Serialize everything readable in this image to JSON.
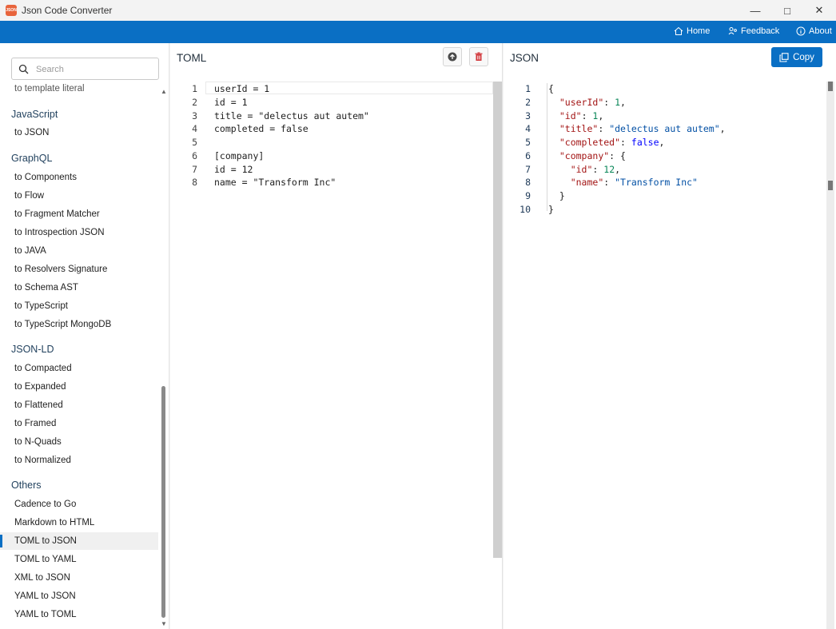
{
  "window": {
    "title": "Json Code Converter",
    "icon_text": "JSON",
    "icon_name": "app-icon"
  },
  "nav": {
    "home": "Home",
    "feedback": "Feedback",
    "about": "About"
  },
  "search": {
    "placeholder": "Search",
    "value": ""
  },
  "sidebar": {
    "cut_item": "to template literal",
    "sections": [
      {
        "title": "JavaScript",
        "items": [
          "to JSON"
        ]
      },
      {
        "title": "GraphQL",
        "items": [
          "to Components",
          "to Flow",
          "to Fragment Matcher",
          "to Introspection JSON",
          "to JAVA",
          "to Resolvers Signature",
          "to Schema AST",
          "to TypeScript",
          "to TypeScript MongoDB"
        ]
      },
      {
        "title": "JSON-LD",
        "items": [
          "to Compacted",
          "to Expanded",
          "to Flattened",
          "to Framed",
          "to N-Quads",
          "to Normalized"
        ]
      },
      {
        "title": "Others",
        "items": [
          "Cadence to Go",
          "Markdown to HTML",
          "TOML to JSON",
          "TOML to YAML",
          "XML to JSON",
          "YAML to JSON",
          "YAML to TOML"
        ]
      }
    ],
    "active_item": "TOML to JSON"
  },
  "left_pane": {
    "title": "TOML",
    "upload_icon": "upload-icon",
    "delete_icon": "trash-icon",
    "lines": [
      "userId = 1",
      "id = 1",
      "title = \"delectus aut autem\"",
      "completed = false",
      "",
      "[company]",
      "id = 12",
      "name = \"Transform Inc\""
    ]
  },
  "right_pane": {
    "title": "JSON",
    "copy_label": "Copy",
    "lines": [
      "{",
      "  \"userId\": 1,",
      "  \"id\": 1,",
      "  \"title\": \"delectus aut autem\",",
      "  \"completed\": false,",
      "  \"company\": {",
      "    \"id\": 12,",
      "    \"name\": \"Transform Inc\"",
      "  }",
      "}"
    ]
  },
  "colors": {
    "accent": "#0a6fc4",
    "delete": "#d13438",
    "json_key": "#a31515",
    "json_string": "#0451a5",
    "json_number": "#098658",
    "json_keyword": "#0000ff"
  }
}
